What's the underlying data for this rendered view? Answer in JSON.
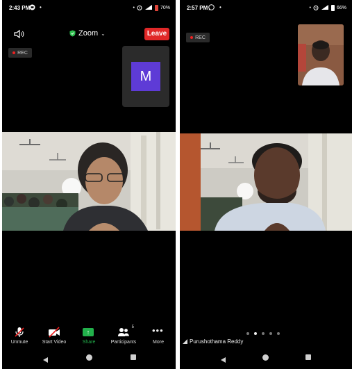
{
  "left_screen": {
    "status": {
      "time": "2:43 PM",
      "battery": "70%"
    },
    "meeting": {
      "title": "Zoom",
      "leave_label": "Leave"
    },
    "rec_label": "REC",
    "self_avatar_letter": "M",
    "toolbar": [
      {
        "label": "Unmute",
        "icon": "muted-mic-icon"
      },
      {
        "label": "Start Video",
        "icon": "video-off-icon"
      },
      {
        "label": "Share",
        "icon": "share-icon"
      },
      {
        "label": "Participants",
        "icon": "participants-icon",
        "count": "5"
      },
      {
        "label": "More",
        "icon": "more-icon"
      }
    ]
  },
  "right_screen": {
    "status": {
      "time": "2:57 PM",
      "battery": "66%"
    },
    "rec_label": "REC",
    "speaker_name": "Purushothama Reddy",
    "page_indicator": {
      "total": 5,
      "active": 1
    }
  },
  "colors": {
    "leave": "#e02828",
    "avatar": "#5e3bd6",
    "share": "#22b04b",
    "rec_dot": "#ee2222"
  }
}
